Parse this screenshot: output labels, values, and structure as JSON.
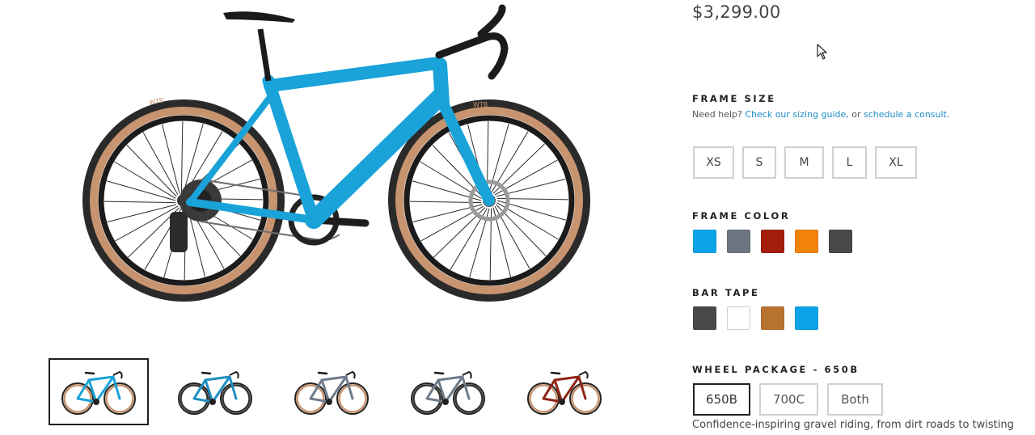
{
  "product": {
    "price": "$3,299.00",
    "hero_frame_color": "#1aa3d9",
    "thumbnails": [
      {
        "frame": "#1aa3d9",
        "tires": "tan",
        "active": true
      },
      {
        "frame": "#1f8ec2",
        "tires": "black",
        "active": false
      },
      {
        "frame": "#6e7b8a",
        "tires": "tan",
        "active": false
      },
      {
        "frame": "#6e7b8a",
        "tires": "black",
        "active": false
      },
      {
        "frame": "#8e2414",
        "tires": "tan",
        "active": false
      }
    ]
  },
  "frame_size": {
    "title": "FRAME SIZE",
    "help_prefix": "Need help?",
    "sizing_link": "Check our sizing guide,",
    "help_or": "or",
    "consult_link": "schedule a consult.",
    "options": [
      "XS",
      "S",
      "M",
      "L",
      "XL"
    ]
  },
  "frame_color": {
    "title": "FRAME COLOR",
    "swatches": [
      "#0aa3e8",
      "#6b7480",
      "#a31f0b",
      "#f08308",
      "#48494b"
    ]
  },
  "bar_tape": {
    "title": "BAR TAPE",
    "swatches": [
      "#48494b",
      "#ffffff",
      "#b97330",
      "#0aa3e8"
    ]
  },
  "wheel_package": {
    "title": "WHEEL PACKAGE - 650B",
    "options": [
      "650B",
      "700C",
      "Both"
    ],
    "selected": "650B",
    "description": "Confidence-inspiring gravel riding, from dirt roads to twisting"
  }
}
